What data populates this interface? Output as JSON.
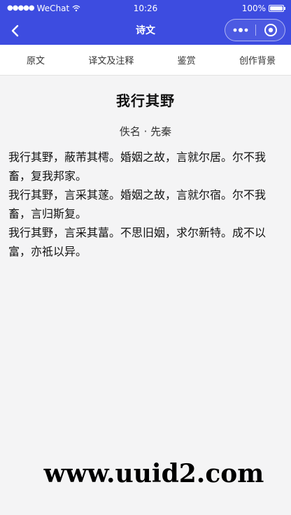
{
  "status_bar": {
    "signal": "●●●●●",
    "carrier": "WeChat",
    "time": "10:26",
    "battery": "100%"
  },
  "navbar": {
    "title": "诗文"
  },
  "tabs": [
    {
      "label": "原文"
    },
    {
      "label": "译文及注释"
    },
    {
      "label": "鉴赏"
    },
    {
      "label": "创作背景"
    }
  ],
  "poem": {
    "title": "我行其野",
    "author": "佚名 · 先秦",
    "stanzas": [
      "我行其野，蔽芾其樗。婚姻之故，言就尔居。尔不我畜，复我邦家。",
      "我行其野，言采其蓫。婚姻之故，言就尔宿。尔不我畜，言归斯复。",
      "我行其野，言采其葍。不思旧姻，求尔新特。成不以富，亦祗以异。"
    ]
  },
  "watermark": "www.uuid2.com",
  "colors": {
    "nav_background": "#3d4ce0",
    "page_background": "#f4f4f5"
  }
}
